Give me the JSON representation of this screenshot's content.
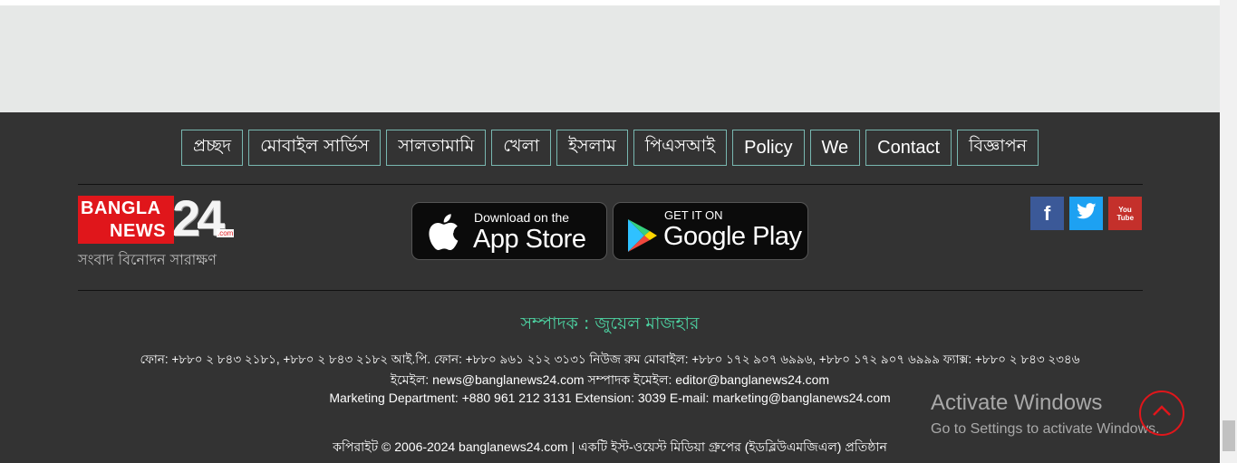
{
  "nav": {
    "items": [
      {
        "label": "প্রচ্ছদ",
        "lang": "bn"
      },
      {
        "label": "মোবাইল সার্ভিস",
        "lang": "bn"
      },
      {
        "label": "সালতামামি",
        "lang": "bn"
      },
      {
        "label": "খেলা",
        "lang": "bn"
      },
      {
        "label": "ইসলাম",
        "lang": "bn"
      },
      {
        "label": "পিএসআই",
        "lang": "bn"
      },
      {
        "label": "Policy",
        "lang": "en"
      },
      {
        "label": "We",
        "lang": "en"
      },
      {
        "label": "Contact",
        "lang": "en"
      },
      {
        "label": "বিজ্ঞাপন",
        "lang": "bn"
      }
    ]
  },
  "logo": {
    "line1": "BANGLA",
    "line2": "NEWS",
    "number": "24",
    "suffix": ".com",
    "tagline": "সংবাদ বিনোদন সারাক্ষণ"
  },
  "app_store": {
    "small": "Download on the",
    "big": "App Store"
  },
  "google_play": {
    "small": "GET IT ON",
    "big": "Google Play"
  },
  "social": {
    "facebook": "f",
    "twitter_icon": "twitter-bird",
    "youtube": "You Tube"
  },
  "colors": {
    "facebook": "#3b5998",
    "twitter": "#1da1f2",
    "youtube": "#c4302b",
    "editor": "#4dd3a2",
    "footer_bg": "#333333"
  },
  "editor_line": "সম্পাদক : জুয়েল মাজহার",
  "info": {
    "phones": "ফোন: +৮৮০ ২ ৮৪৩ ২১৮১, +৮৮০ ২ ৮৪৩ ২১৮২ আই.পি. ফোন: +৮৮০ ৯৬১ ২১২ ৩১৩১ নিউজ রুম মোবাইল: +৮৮০ ১৭২ ৯০৭ ৬৯৯৬, +৮৮০ ১৭২ ৯০৭ ৬৯৯৯ ফ্যাক্স: +৮৮০ ২ ৮৪৩ ২৩৪৬",
    "emails": "ইমেইল: news@banglanews24.com সম্পাদক ইমেইল: editor@banglanews24.com",
    "marketing": "Marketing Department: +880 961 212 3131 Extension: 3039 E-mail: marketing@banglanews24.com",
    "copyright": "কপিরাইট © 2006-2024 banglanews24.com | একটি ইস্ট-ওয়েস্ট মিডিয়া গ্রুপের (ইডব্লিউএমজিএল) প্রতিষ্ঠান"
  },
  "watermark": {
    "title": "Activate Windows",
    "subtitle": "Go to Settings to activate Windows."
  }
}
